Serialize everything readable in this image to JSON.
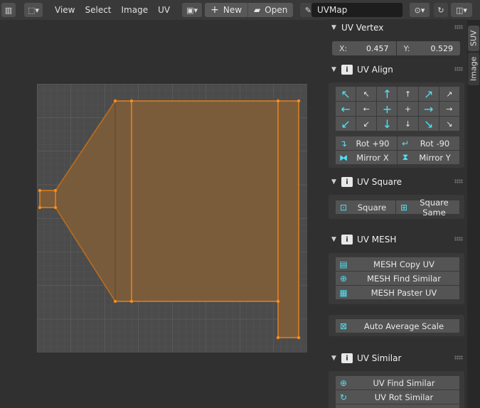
{
  "header": {
    "menus": [
      "View",
      "Select",
      "Image",
      "UV"
    ],
    "new_label": "New",
    "open_label": "Open",
    "uvmap_name": "UVMap"
  },
  "tabs": [
    "SUV",
    "Image"
  ],
  "uv_vertex": {
    "title": "UV Vertex",
    "x_label": "X:",
    "x_value": "0.457",
    "y_label": "Y:",
    "y_value": "0.529"
  },
  "uv_align": {
    "title": "UV Align",
    "grid": [
      [
        "↖",
        "↖",
        "↑",
        "↑",
        "↗",
        "↗"
      ],
      [
        "←",
        "←",
        "+",
        "+",
        "→",
        "→"
      ],
      [
        "↙",
        "↙",
        "↓",
        "↓",
        "↘",
        "↘"
      ]
    ],
    "rot_plus": "Rot +90",
    "rot_minus": "Rot -90",
    "mirror_x": "Mirror X",
    "mirror_y": "Mirror Y"
  },
  "uv_square": {
    "title": "UV Square",
    "square": "Square",
    "square_same": "Square Same"
  },
  "uv_mesh": {
    "title": "UV MESH",
    "copy": "MESH Copy UV",
    "find": "MESH Find Similar",
    "paste": "MESH Paster UV",
    "auto_avg": "Auto Average Scale"
  },
  "uv_similar": {
    "title": "UV Similar",
    "find": "UV Find Similar",
    "rot": "UV Rot Similar"
  },
  "colors": {
    "accent": "#4fe3f5",
    "uv_fill": "#7a5c3a",
    "uv_edge": "#ff8c1a"
  }
}
